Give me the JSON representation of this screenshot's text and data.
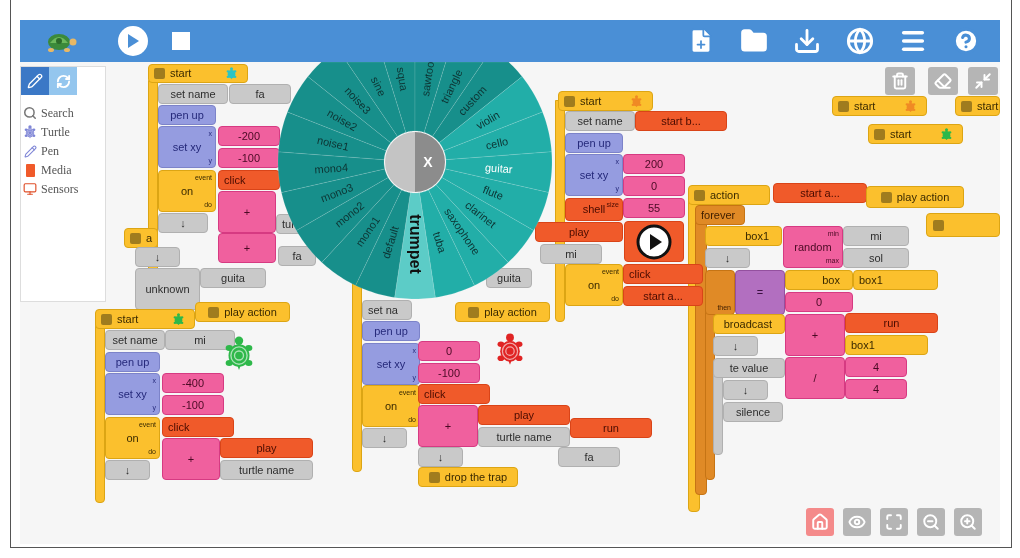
{
  "palette": {
    "tabs": [
      {
        "selected": true
      },
      {
        "selected": false
      }
    ],
    "items": [
      {
        "label": "Search"
      },
      {
        "label": "Turtle"
      },
      {
        "label": "Pen"
      },
      {
        "label": "Media"
      },
      {
        "label": "Sensors"
      }
    ]
  },
  "blocks": [
    {
      "kind": "hat",
      "label": "start",
      "color": "#2bc4c4"
    },
    {
      "kind": "value",
      "label": "set name"
    },
    {
      "kind": "value",
      "label": "fa"
    },
    {
      "kind": "pen",
      "label": "pen up"
    },
    {
      "kind": "pen",
      "label": "set xy",
      "ports": [
        "x",
        "y"
      ]
    },
    {
      "kind": "number",
      "label": "-200"
    },
    {
      "kind": "number",
      "label": "-100"
    },
    {
      "kind": "flow",
      "label": "on",
      "ports": [
        "event",
        "do"
      ]
    },
    {
      "kind": "media",
      "label": "click"
    },
    {
      "kind": "number",
      "label": "+"
    },
    {
      "kind": "value",
      "label": "↓"
    },
    {
      "kind": "hat",
      "label": "a"
    },
    {
      "kind": "value",
      "label": "tur"
    },
    {
      "kind": "number",
      "label": "+"
    },
    {
      "kind": "value",
      "label": "↓"
    },
    {
      "kind": "value",
      "label": "fa"
    },
    {
      "kind": "value",
      "label": "unknown"
    },
    {
      "kind": "value",
      "label": "guita"
    },
    {
      "kind": "hat",
      "label": "start",
      "color": "#2eb84a"
    },
    {
      "kind": "hat",
      "label": "play action"
    },
    {
      "kind": "value",
      "label": "set name"
    },
    {
      "kind": "value",
      "label": "mi"
    },
    {
      "kind": "pen",
      "label": "pen up"
    },
    {
      "kind": "pen",
      "label": "set xy",
      "ports": [
        "x",
        "y"
      ]
    },
    {
      "kind": "number",
      "label": "-400"
    },
    {
      "kind": "number",
      "label": "-100"
    },
    {
      "kind": "flow",
      "label": "on",
      "ports": [
        "event",
        "do"
      ]
    },
    {
      "kind": "media",
      "label": "click"
    },
    {
      "kind": "number",
      "label": "+"
    },
    {
      "kind": "media",
      "label": "play"
    },
    {
      "kind": "value",
      "label": "↓"
    },
    {
      "kind": "value",
      "label": "turtle name"
    },
    {
      "kind": "value",
      "label": "set na"
    },
    {
      "kind": "value",
      "label": "guita"
    },
    {
      "kind": "hat",
      "label": "play action"
    },
    {
      "kind": "pen",
      "label": "pen up"
    },
    {
      "kind": "pen",
      "label": "set xy",
      "ports": [
        "x",
        "y"
      ]
    },
    {
      "kind": "number",
      "label": "0"
    },
    {
      "kind": "number",
      "label": "-100"
    },
    {
      "kind": "flow",
      "label": "on",
      "ports": [
        "event",
        "do"
      ]
    },
    {
      "kind": "media",
      "label": "click"
    },
    {
      "kind": "number",
      "label": "+"
    },
    {
      "kind": "media",
      "label": "play"
    },
    {
      "kind": "media",
      "label": "run"
    },
    {
      "kind": "value",
      "label": "↓"
    },
    {
      "kind": "value",
      "label": "turtle name"
    },
    {
      "kind": "value",
      "label": "↓"
    },
    {
      "kind": "value",
      "label": "fa"
    },
    {
      "kind": "hat",
      "label": "drop the trap"
    },
    {
      "kind": "hat",
      "label": "start",
      "color": "#f08a24"
    },
    {
      "kind": "value",
      "label": "set name"
    },
    {
      "kind": "media",
      "label": "start b..."
    },
    {
      "kind": "pen",
      "label": "pen up"
    },
    {
      "kind": "pen",
      "label": "set xy",
      "ports": [
        "x",
        "y"
      ]
    },
    {
      "kind": "number",
      "label": "200"
    },
    {
      "kind": "number",
      "label": "0"
    },
    {
      "kind": "media",
      "label": "shell",
      "ports": [
        "size"
      ]
    },
    {
      "kind": "number",
      "label": "55"
    },
    {
      "kind": "media",
      "label": "play"
    },
    {
      "kind": "value",
      "label": "mi"
    },
    {
      "kind": "flow",
      "label": "on",
      "ports": [
        "event",
        "do"
      ]
    },
    {
      "kind": "media",
      "label": "click"
    },
    {
      "kind": "media",
      "label": "start a..."
    },
    {
      "kind": "hat",
      "label": "action"
    },
    {
      "kind": "media",
      "label": "start a..."
    },
    {
      "kind": "hat",
      "label": "play action"
    },
    {
      "kind": "control",
      "label": "forever"
    },
    {
      "kind": "flow",
      "label": "box1"
    },
    {
      "kind": "number",
      "label": "random",
      "ports": [
        "min",
        "max"
      ]
    },
    {
      "kind": "value",
      "label": "mi"
    },
    {
      "kind": "value",
      "label": "↓"
    },
    {
      "kind": "value",
      "label": "sol"
    },
    {
      "kind": "control",
      "ports": [
        "then"
      ]
    },
    {
      "kind": "boolean",
      "label": "="
    },
    {
      "kind": "flow",
      "label": "box"
    },
    {
      "kind": "flow",
      "label": "box1"
    },
    {
      "kind": "number",
      "label": "0"
    },
    {
      "kind": "flow",
      "label": "broadcast"
    },
    {
      "kind": "number",
      "label": "+"
    },
    {
      "kind": "media",
      "label": "run"
    },
    {
      "kind": "value",
      "label": "↓"
    },
    {
      "kind": "flow",
      "label": "box1"
    },
    {
      "kind": "value",
      "label": "te value"
    },
    {
      "kind": "number",
      "label": "/"
    },
    {
      "kind": "number",
      "label": "4"
    },
    {
      "kind": "value",
      "label": "↓"
    },
    {
      "kind": "number",
      "label": "4"
    },
    {
      "kind": "value",
      "label": "silence"
    },
    {
      "kind": "hat",
      "label": "start",
      "color": "#f08a24"
    },
    {
      "kind": "hat",
      "label": "start",
      "color": "#2eb84a"
    },
    {
      "kind": "hat",
      "label": "start"
    }
  ],
  "turtles": [
    {
      "color": "#2eb84a"
    },
    {
      "color": "#e02424"
    }
  ],
  "pie_menu": {
    "close": "X",
    "items": [
      {
        "label": "trumpet",
        "kind": "instrument",
        "selected": true,
        "current": false
      },
      {
        "label": "default",
        "kind": "synth",
        "selected": false,
        "current": false
      },
      {
        "label": "mono1",
        "kind": "synth",
        "selected": false,
        "current": false
      },
      {
        "label": "mono2",
        "kind": "synth",
        "selected": false,
        "current": false
      },
      {
        "label": "mono3",
        "kind": "synth",
        "selected": false,
        "current": false
      },
      {
        "label": "mono4",
        "kind": "synth",
        "selected": false,
        "current": false
      },
      {
        "label": "noise1",
        "kind": "synth",
        "selected": false,
        "current": false
      },
      {
        "label": "noise2",
        "kind": "synth",
        "selected": false,
        "current": false
      },
      {
        "label": "noise3",
        "kind": "synth",
        "selected": false,
        "current": false
      },
      {
        "label": "sine",
        "kind": "synth",
        "selected": false,
        "current": false
      },
      {
        "label": "squa",
        "kind": "synth",
        "selected": false,
        "current": false
      },
      {
        "label": "sawtoo",
        "kind": "synth",
        "selected": false,
        "current": false
      },
      {
        "label": "triangle",
        "kind": "synth",
        "selected": false,
        "current": false
      },
      {
        "label": "custom",
        "kind": "synth",
        "selected": false,
        "current": false
      },
      {
        "label": "violin",
        "kind": "instrument",
        "selected": false,
        "current": false
      },
      {
        "label": "cello",
        "kind": "instrument",
        "selected": false,
        "current": false
      },
      {
        "label": "guitar",
        "kind": "instrument",
        "selected": false,
        "current": true
      },
      {
        "label": "flute",
        "kind": "instrument",
        "selected": false,
        "current": false
      },
      {
        "label": "clarinet",
        "kind": "instrument",
        "selected": false,
        "current": false
      },
      {
        "label": "saxophone",
        "kind": "instrument",
        "selected": false,
        "current": false
      },
      {
        "label": "tuba",
        "kind": "instrument",
        "selected": false,
        "current": false
      }
    ]
  }
}
